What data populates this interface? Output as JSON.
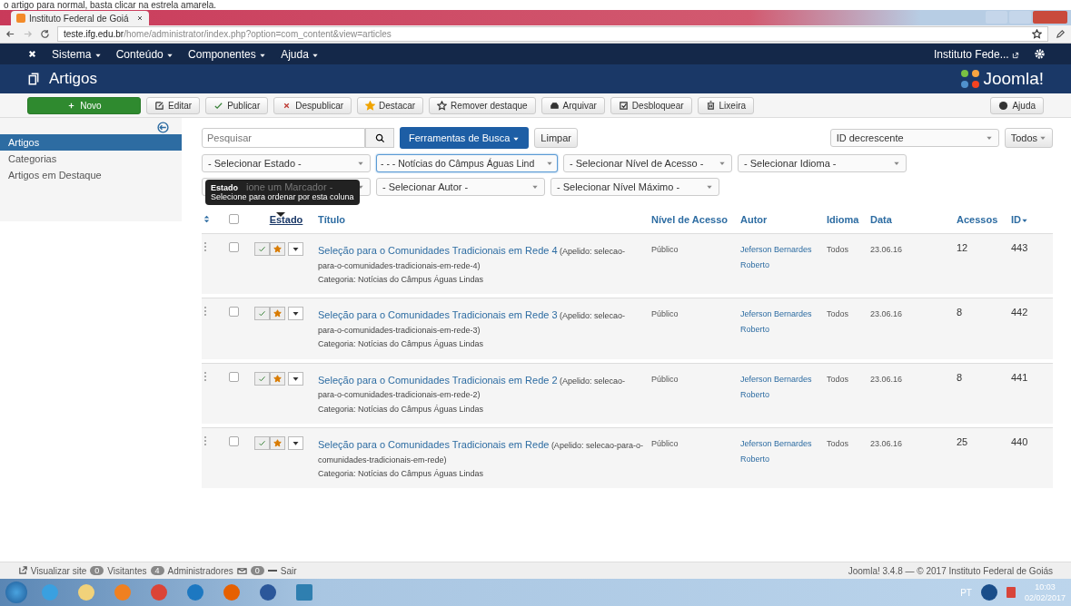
{
  "doc_caption": "o artigo para normal, basta clicar na estrela amarela.",
  "browser": {
    "tab_title": "Instituto Federal de Goiá",
    "url_host": "teste.ifg.edu.br",
    "url_path": "/home/administrator/index.php?option=com_content&view=articles"
  },
  "navbar": {
    "menus": [
      "Sistema",
      "Conteúdo",
      "Componentes",
      "Ajuda"
    ],
    "site_link": "Instituto Fede..."
  },
  "header": {
    "title": "Artigos",
    "logo_text": "Joomla!"
  },
  "toolbar": [
    {
      "label": "Novo",
      "kind": "new"
    },
    {
      "label": "Editar",
      "kind": "edit"
    },
    {
      "label": "Publicar",
      "kind": "publish"
    },
    {
      "label": "Despublicar",
      "kind": "unpublish"
    },
    {
      "label": "Destacar",
      "kind": "feature"
    },
    {
      "label": "Remover destaque",
      "kind": "unfeature"
    },
    {
      "label": "Arquivar",
      "kind": "archive"
    },
    {
      "label": "Desbloquear",
      "kind": "checkin"
    },
    {
      "label": "Lixeira",
      "kind": "trash"
    }
  ],
  "help_button": "Ajuda",
  "sidebar": {
    "items": [
      {
        "label": "Artigos",
        "selected": true
      },
      {
        "label": "Categorias",
        "selected": false
      },
      {
        "label": "Artigos em Destaque",
        "selected": false
      }
    ]
  },
  "search": {
    "placeholder": "Pesquisar",
    "tools_button": "Ferramentas de Busca",
    "clear_button": "Limpar",
    "ordering": "ID decrescente",
    "limit": "Todos"
  },
  "filters": [
    [
      "- Selecionar Estado -",
      "- - - Notícias do Câmpus Águas Lind",
      "- Selecionar Nível de Acesso -",
      "- Selecionar Idioma -"
    ],
    [
      "ione um Marcador -",
      "- Selecionar Autor -",
      "- Selecionar Nível Máximo -"
    ]
  ],
  "tooltip": {
    "title": "Estado",
    "text": "Selecione para ordenar por esta coluna"
  },
  "table": {
    "all_checked": false,
    "columns": [
      {
        "label": "Estado",
        "sorted": false
      },
      {
        "label": "Título",
        "sorted": false
      },
      {
        "label": "Nível de Acesso",
        "sorted": false
      },
      {
        "label": "Autor",
        "sorted": false
      },
      {
        "label": "Idioma",
        "sorted": false
      },
      {
        "label": "Data",
        "sorted": false
      },
      {
        "label": "Acessos",
        "sorted": false
      },
      {
        "label": "ID",
        "sorted": true
      }
    ],
    "rows": [
      {
        "checked": false,
        "published": true,
        "featured": true,
        "title": "Seleção para o Comunidades Tradicionais em Rede 4",
        "alias": "(Apelido: selecao-para-o-comunidades-tradicionais-em-rede-4)",
        "category": "Categoria: Notícias do Câmpus Águas Lindas",
        "access": "Público",
        "author": "Jeferson Bernardes Roberto",
        "language": "Todos",
        "date": "23.06.16",
        "hits": "12",
        "id": "443"
      },
      {
        "checked": false,
        "published": true,
        "featured": true,
        "title": "Seleção para o Comunidades Tradicionais em Rede 3",
        "alias": "(Apelido: selecao-para-o-comunidades-tradicionais-em-rede-3)",
        "category": "Categoria: Notícias do Câmpus Águas Lindas",
        "access": "Público",
        "author": "Jeferson Bernardes Roberto",
        "language": "Todos",
        "date": "23.06.16",
        "hits": "8",
        "id": "442"
      },
      {
        "checked": false,
        "published": true,
        "featured": true,
        "title": "Seleção para o Comunidades Tradicionais em Rede 2",
        "alias": "(Apelido: selecao-para-o-comunidades-tradicionais-em-rede-2)",
        "category": "Categoria: Notícias do Câmpus Águas Lindas",
        "access": "Público",
        "author": "Jeferson Bernardes Roberto",
        "language": "Todos",
        "date": "23.06.16",
        "hits": "8",
        "id": "441"
      },
      {
        "checked": false,
        "published": true,
        "featured": true,
        "title": "Seleção para o Comunidades Tradicionais em Rede",
        "alias": "(Apelido: selecao-para-o-comunidades-tradicionais-em-rede)",
        "category": "Categoria: Notícias do Câmpus Águas Lindas",
        "access": "Público",
        "author": "Jeferson Bernardes Roberto",
        "language": "Todos",
        "date": "23.06.16",
        "hits": "25",
        "id": "440"
      }
    ]
  },
  "status_bar": {
    "view_site": "Visualizar site",
    "visitors_count": "0",
    "visitors": "Visitantes",
    "admins_count": "4",
    "admins": "Administradores",
    "messages_count": "0",
    "logout": "Sair",
    "version": "Joomla! 3.4.8 — © 2017 Instituto Federal de Goiás"
  },
  "taskbar": {
    "language": "PT",
    "time": "10:03",
    "date": "02/02/2017"
  }
}
